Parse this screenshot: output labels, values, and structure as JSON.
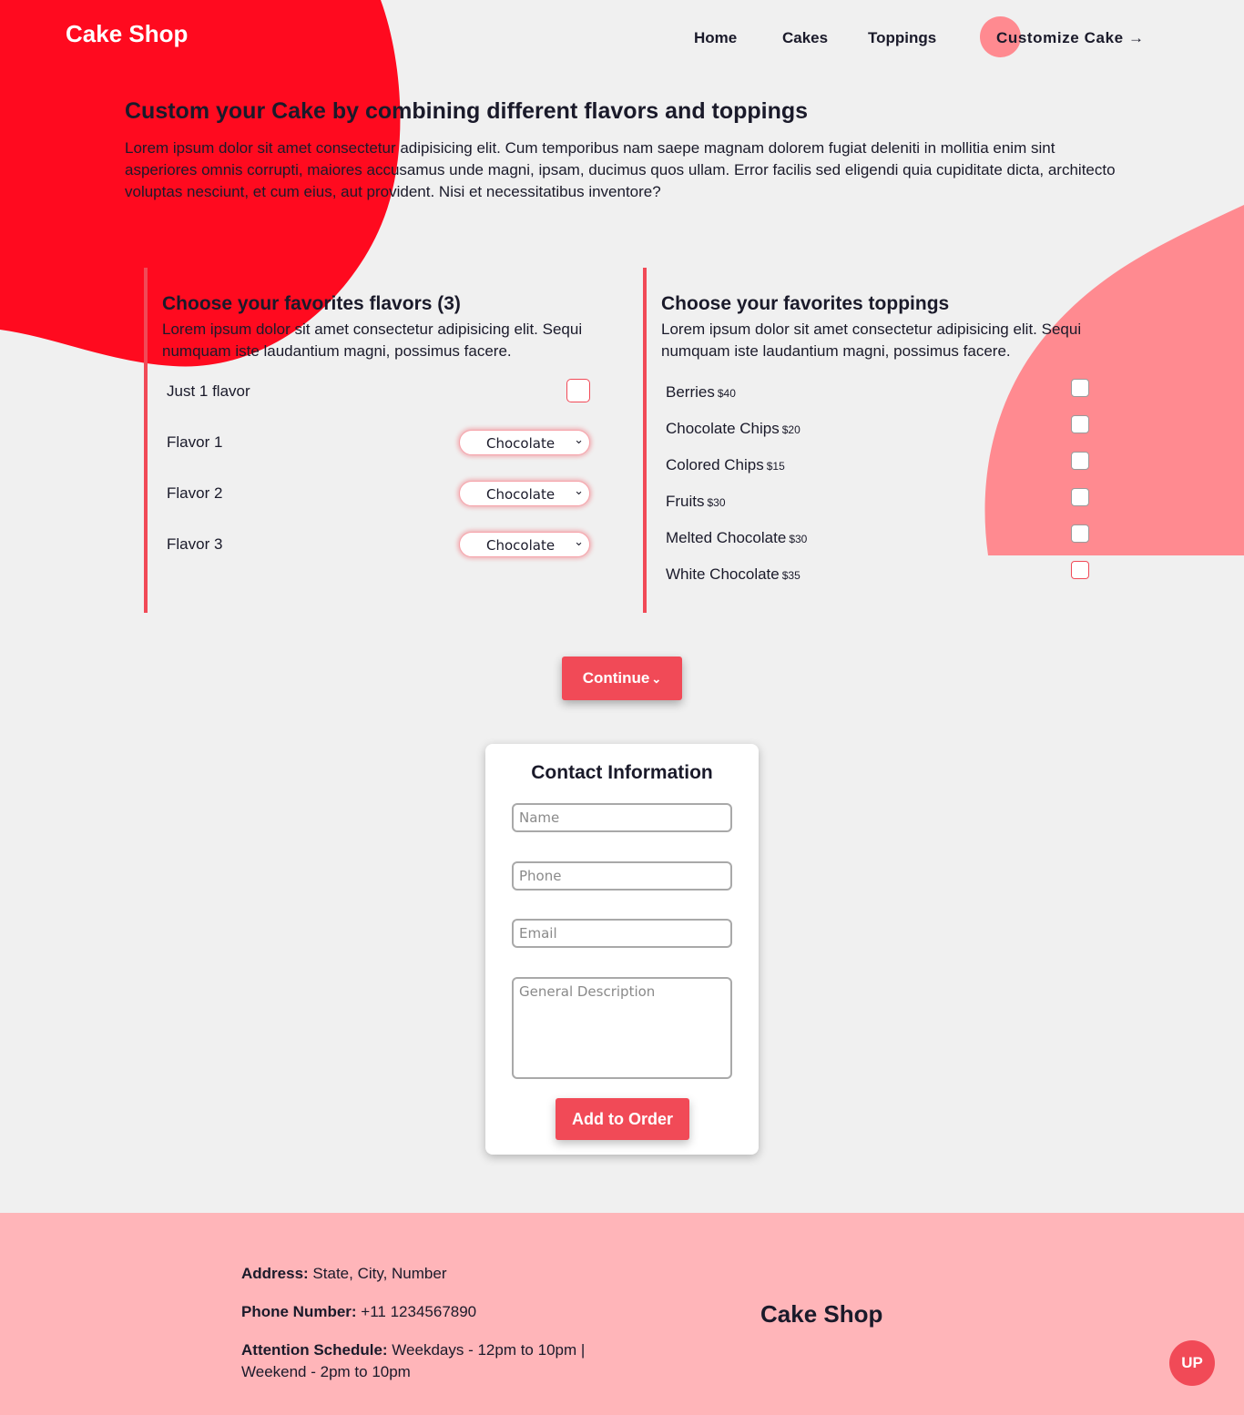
{
  "header": {
    "brand": "Cake Shop",
    "nav": [
      {
        "label": "Home"
      },
      {
        "label": "Cakes"
      },
      {
        "label": "Toppings"
      },
      {
        "label": "Customize Cake →"
      }
    ]
  },
  "intro": {
    "title": "Custom your Cake by combining different flavors and toppings",
    "text": "Lorem ipsum dolor sit amet consectetur adipisicing elit. Cum temporibus nam saepe magnam dolorem fugiat deleniti in mollitia enim sint asperiores omnis corrupti, maiores accusamus unde magni, ipsam, ducimus quos ullam. Error facilis sed eligendi quia cupiditate dicta, architecto voluptas nesciunt, et cum eius, aut provident. Nisi et necessitatibus inventore?"
  },
  "flavors": {
    "title": "Choose your favorites flavors (3)",
    "text": "Lorem ipsum dolor sit amet consectetur adipisicing elit. Sequi numquam iste laudantium magni, possimus facere.",
    "just_one_label": "Just 1 flavor",
    "just_one_checked": false,
    "selects": [
      {
        "label": "Flavor 1",
        "value": "Chocolate"
      },
      {
        "label": "Flavor 2",
        "value": "Chocolate"
      },
      {
        "label": "Flavor 3",
        "value": "Chocolate"
      }
    ]
  },
  "toppings": {
    "title": "Choose your favorites toppings",
    "text": "Lorem ipsum dolor sit amet consectetur adipisicing elit. Sequi numquam iste laudantium magni, possimus facere.",
    "items": [
      {
        "name": "Berries",
        "price": "$40",
        "checked": false
      },
      {
        "name": "Chocolate Chips",
        "price": "$20",
        "checked": false
      },
      {
        "name": "Colored Chips",
        "price": "$15",
        "checked": false
      },
      {
        "name": "Fruits",
        "price": "$30",
        "checked": false
      },
      {
        "name": "Melted Chocolate",
        "price": "$30",
        "checked": false
      },
      {
        "name": "White Chocolate",
        "price": "$35",
        "checked": false
      }
    ]
  },
  "continue_label": "Continue",
  "contact": {
    "title": "Contact Information",
    "name_placeholder": "Name",
    "phone_placeholder": "Phone",
    "email_placeholder": "Email",
    "description_placeholder": "General Description",
    "submit_label": "Add to Order"
  },
  "footer": {
    "address_label": "Address:",
    "address_value": "State, City, Number",
    "phone_label": "Phone Number:",
    "phone_value": "+11 1234567890",
    "schedule_label": "Attention Schedule:",
    "schedule_value": "Weekdays - 12pm to 10pm | Weekend - 2pm to 10pm",
    "brand": "Cake Shop",
    "up_label": "UP"
  },
  "colors": {
    "accent": "#f14a57",
    "blob_red": "#ff0a1f",
    "blob_pink": "#ff8a90",
    "footer_bg": "#ffb5b9",
    "page_bg": "#f0f0f0"
  }
}
